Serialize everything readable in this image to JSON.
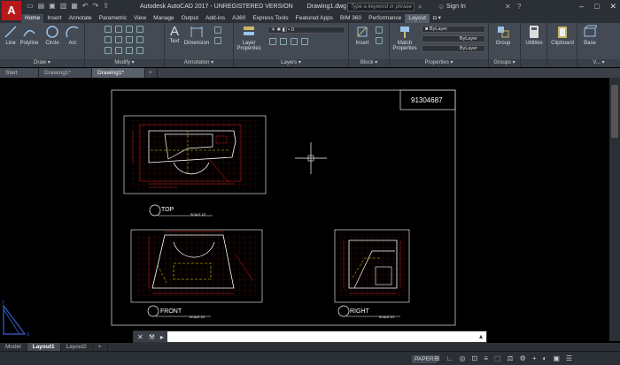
{
  "app": {
    "logo": "A",
    "title": "Autodesk AutoCAD 2017 - UNREGISTERED VERSION",
    "file": "Drawing1.dwg",
    "search_placeholder": "Type a keyword or phrase",
    "sign_in": "Sign In"
  },
  "ribbon_tabs": [
    "Home",
    "Insert",
    "Annotate",
    "Parametric",
    "View",
    "Manage",
    "Output",
    "Add-ins",
    "A360",
    "Express Tools",
    "Featured Apps",
    "BIM 360",
    "Performance",
    "Layout"
  ],
  "ribbon": {
    "draw": {
      "label": "Draw",
      "tools": [
        "Line",
        "Polyline",
        "Circle",
        "Arc"
      ]
    },
    "modify": {
      "label": "Modify"
    },
    "annotation": {
      "label": "Annotation",
      "tools": [
        "Text",
        "Dimension"
      ]
    },
    "layers": {
      "label": "Layers",
      "tool": "Layer Properties",
      "current": "0"
    },
    "block": {
      "label": "Block",
      "tool": "Insert"
    },
    "properties": {
      "label": "Properties",
      "tool": "Match Properties",
      "combos": [
        "ByLayer",
        "ByLayer",
        "ByLayer"
      ]
    },
    "groups": {
      "label": "Groups",
      "tool": "Group"
    },
    "utilities": {
      "tool": "Utilities"
    },
    "clipboard": {
      "tool": "Clipboard"
    },
    "view": {
      "tool": "Base",
      "label": "V..."
    }
  },
  "file_tabs": [
    "Start",
    "Drawing1*",
    "Drawing1*"
  ],
  "drawing": {
    "title_block": "91304687",
    "views": [
      {
        "name": "TOP",
        "scale": "SCALE 1/2"
      },
      {
        "name": "FRONT",
        "scale": "SCALE 1/2"
      },
      {
        "name": "RIGHT",
        "scale": "SCALE 1/2"
      }
    ],
    "ucs": {
      "x": "X",
      "y": "Y"
    }
  },
  "layout_tabs": [
    "Model",
    "Layout1",
    "Layout2"
  ],
  "status": {
    "paper": "PAPER"
  },
  "colors": {
    "dim": "#e02020",
    "geom": "#ffffff",
    "hidden": "#e8e000",
    "grid": "#5a0e0e"
  }
}
